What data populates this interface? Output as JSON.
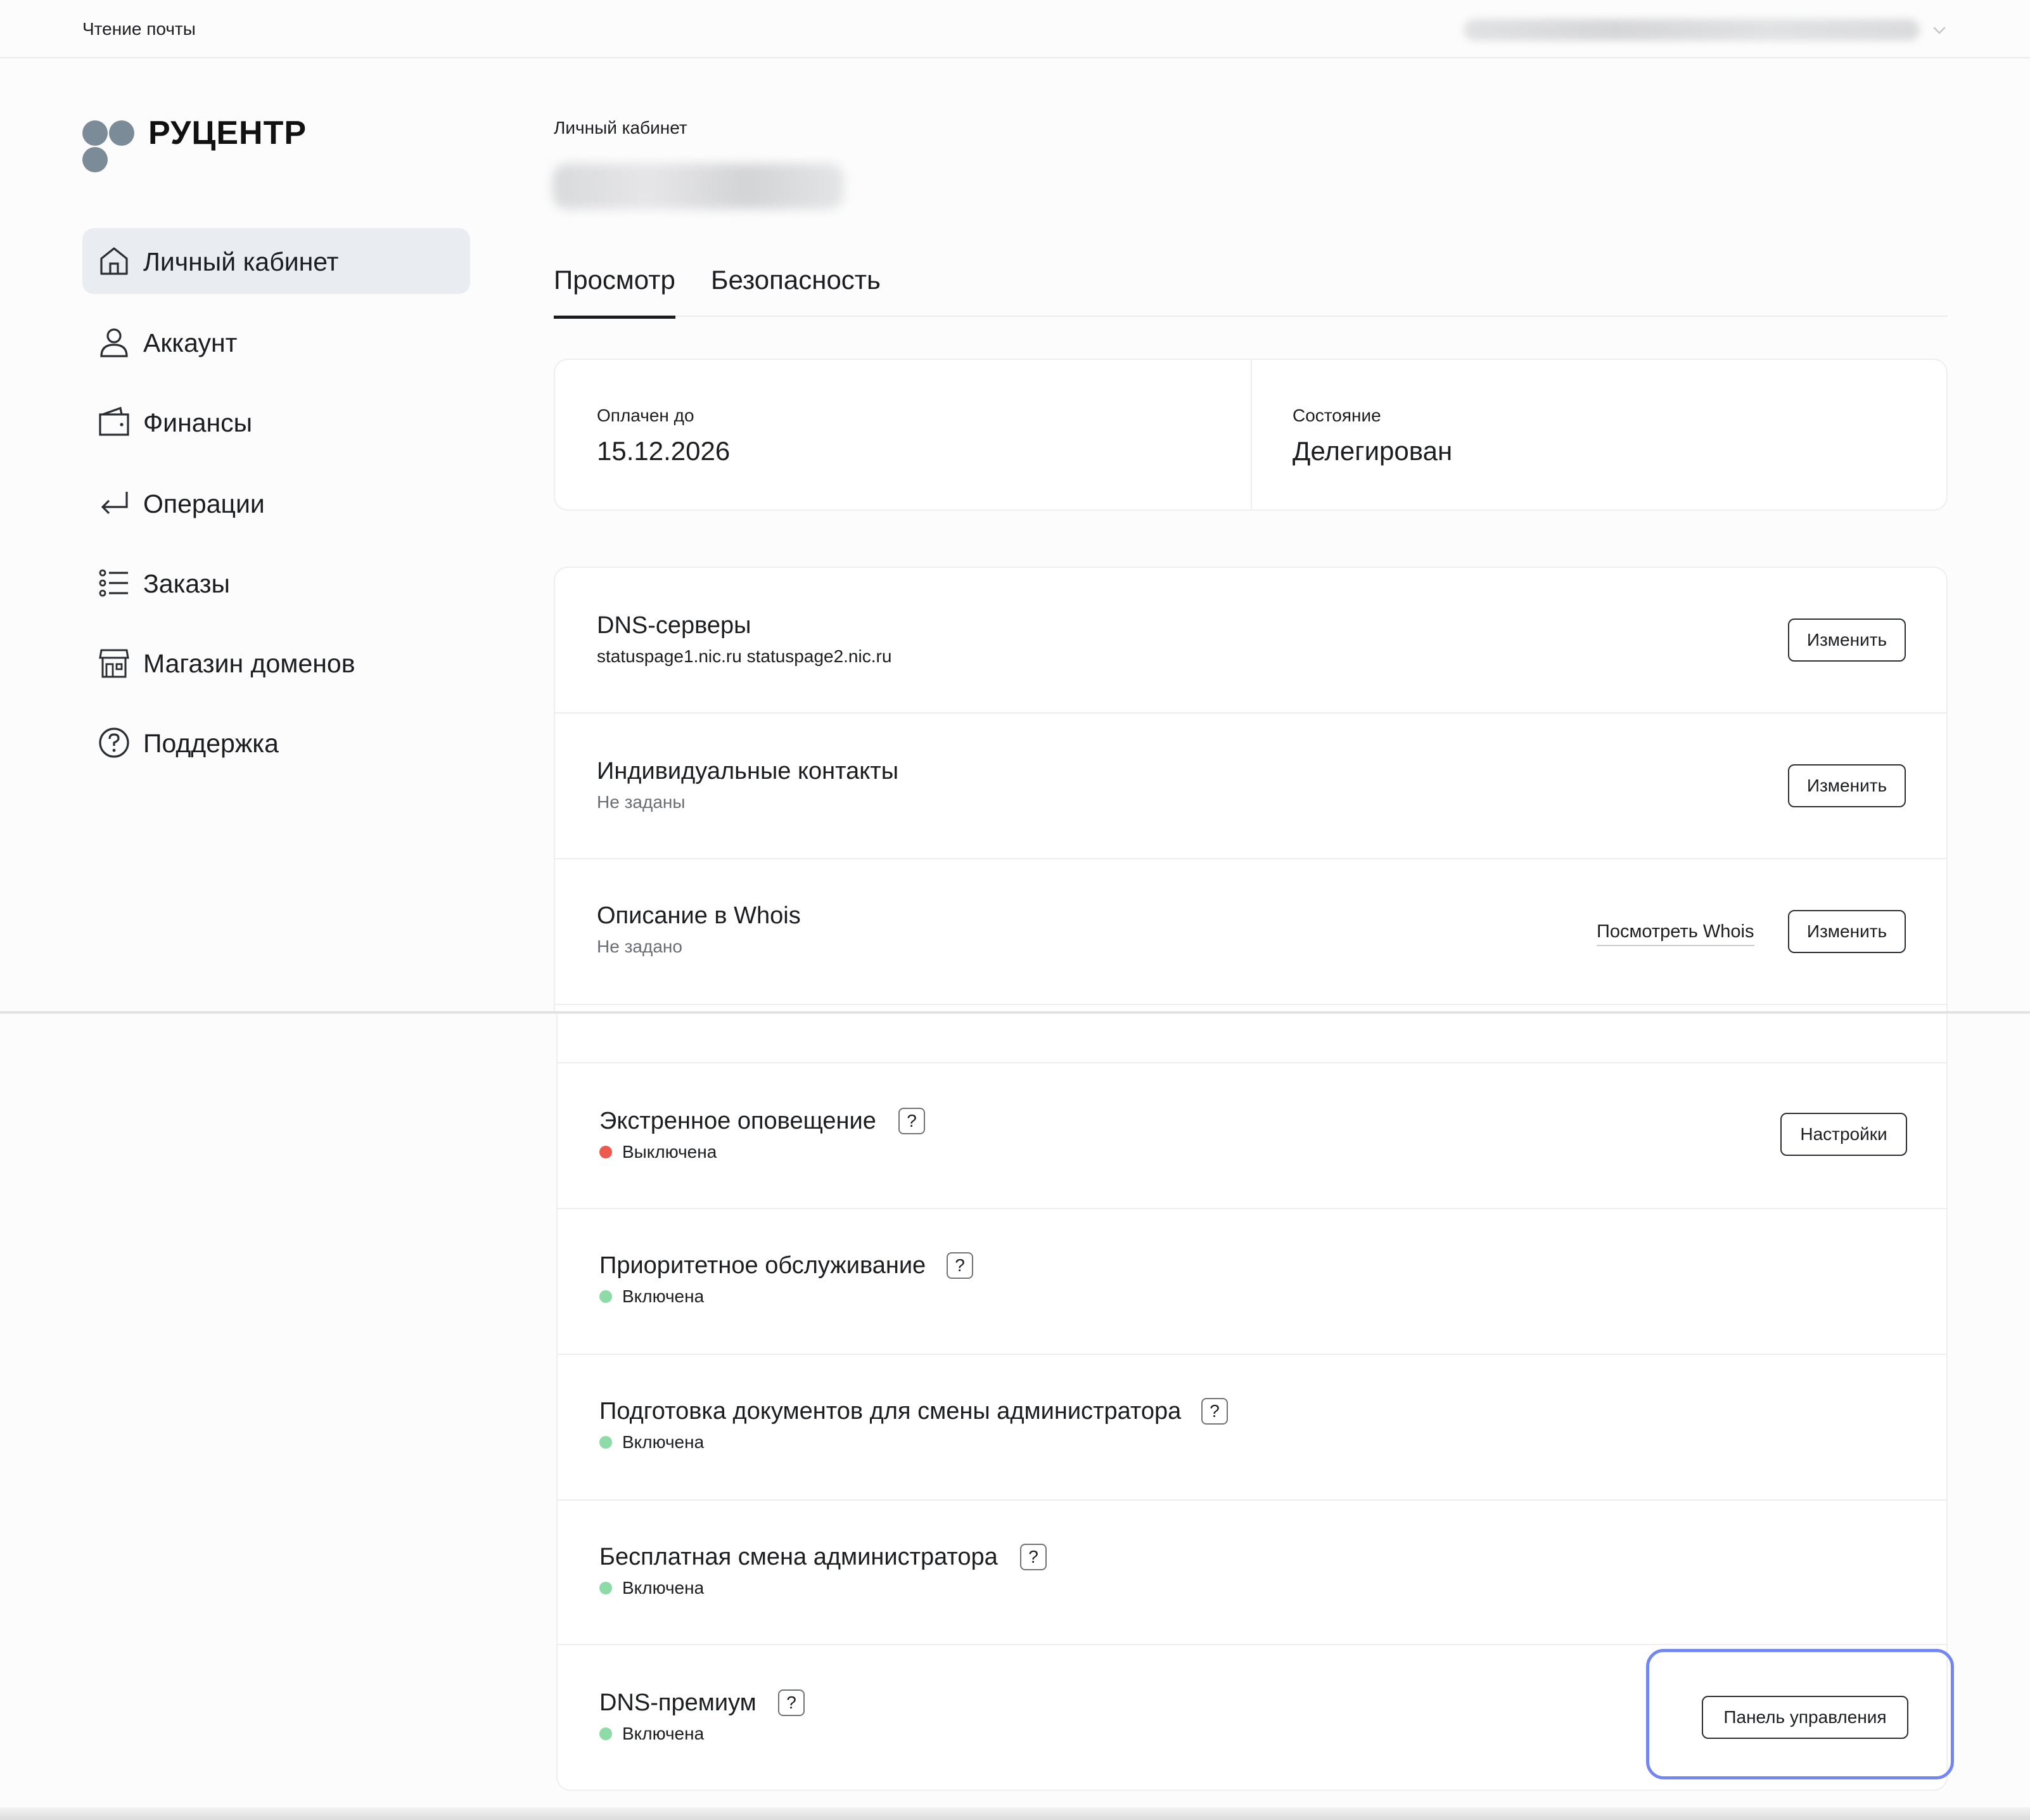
{
  "topbar": {
    "mail_link": "Чтение почты"
  },
  "logo": {
    "text": "РУЦЕНТР"
  },
  "sidebar": {
    "items": [
      {
        "label": "Личный кабинет",
        "icon": "home-icon",
        "active": true
      },
      {
        "label": "Аккаунт",
        "icon": "user-icon"
      },
      {
        "label": "Финансы",
        "icon": "wallet-icon"
      },
      {
        "label": "Операции",
        "icon": "return-arrow-icon"
      },
      {
        "label": "Заказы",
        "icon": "list-icon"
      },
      {
        "label": "Магазин доменов",
        "icon": "store-icon"
      },
      {
        "label": "Поддержка",
        "icon": "question-circle-icon"
      }
    ]
  },
  "header": {
    "breadcrumb": "Личный кабинет"
  },
  "tabs": [
    {
      "label": "Просмотр",
      "active": true
    },
    {
      "label": "Безопасность"
    }
  ],
  "info": {
    "paid_until_label": "Оплачен до",
    "paid_until_value": "15.12.2026",
    "state_label": "Состояние",
    "state_value": "Делегирован"
  },
  "rows": {
    "dns": {
      "title": "DNS-серверы",
      "sub": "statuspage1.nic.ru statuspage2.nic.ru",
      "button": "Изменить"
    },
    "contacts": {
      "title": "Индивидуальные контакты",
      "sub": "Не заданы",
      "button": "Изменить"
    },
    "whois": {
      "title": "Описание в Whois",
      "sub": "Не задано",
      "link": "Посмотреть Whois",
      "button": "Изменить"
    },
    "emergency": {
      "title": "Экстренное оповещение",
      "help": "?",
      "status": "Выключена",
      "button": "Настройки"
    },
    "priority": {
      "title": "Приоритетное обслуживание",
      "help": "?",
      "status": "Включена"
    },
    "docs": {
      "title": "Подготовка документов для смены администратора",
      "help": "?",
      "status": "Включена"
    },
    "free_admin": {
      "title": "Бесплатная смена администратора",
      "help": "?",
      "status": "Включена"
    },
    "dns_premium": {
      "title": "DNS-премиум",
      "help": "?",
      "status": "Включена",
      "button": "Панель управления"
    }
  },
  "colors": {
    "status_off": "#ef5a4f",
    "status_on": "#8ddba6",
    "active_nav_bg": "#e9edf1",
    "logo_dots": "#7b8c98",
    "highlight": "#7287f2"
  }
}
